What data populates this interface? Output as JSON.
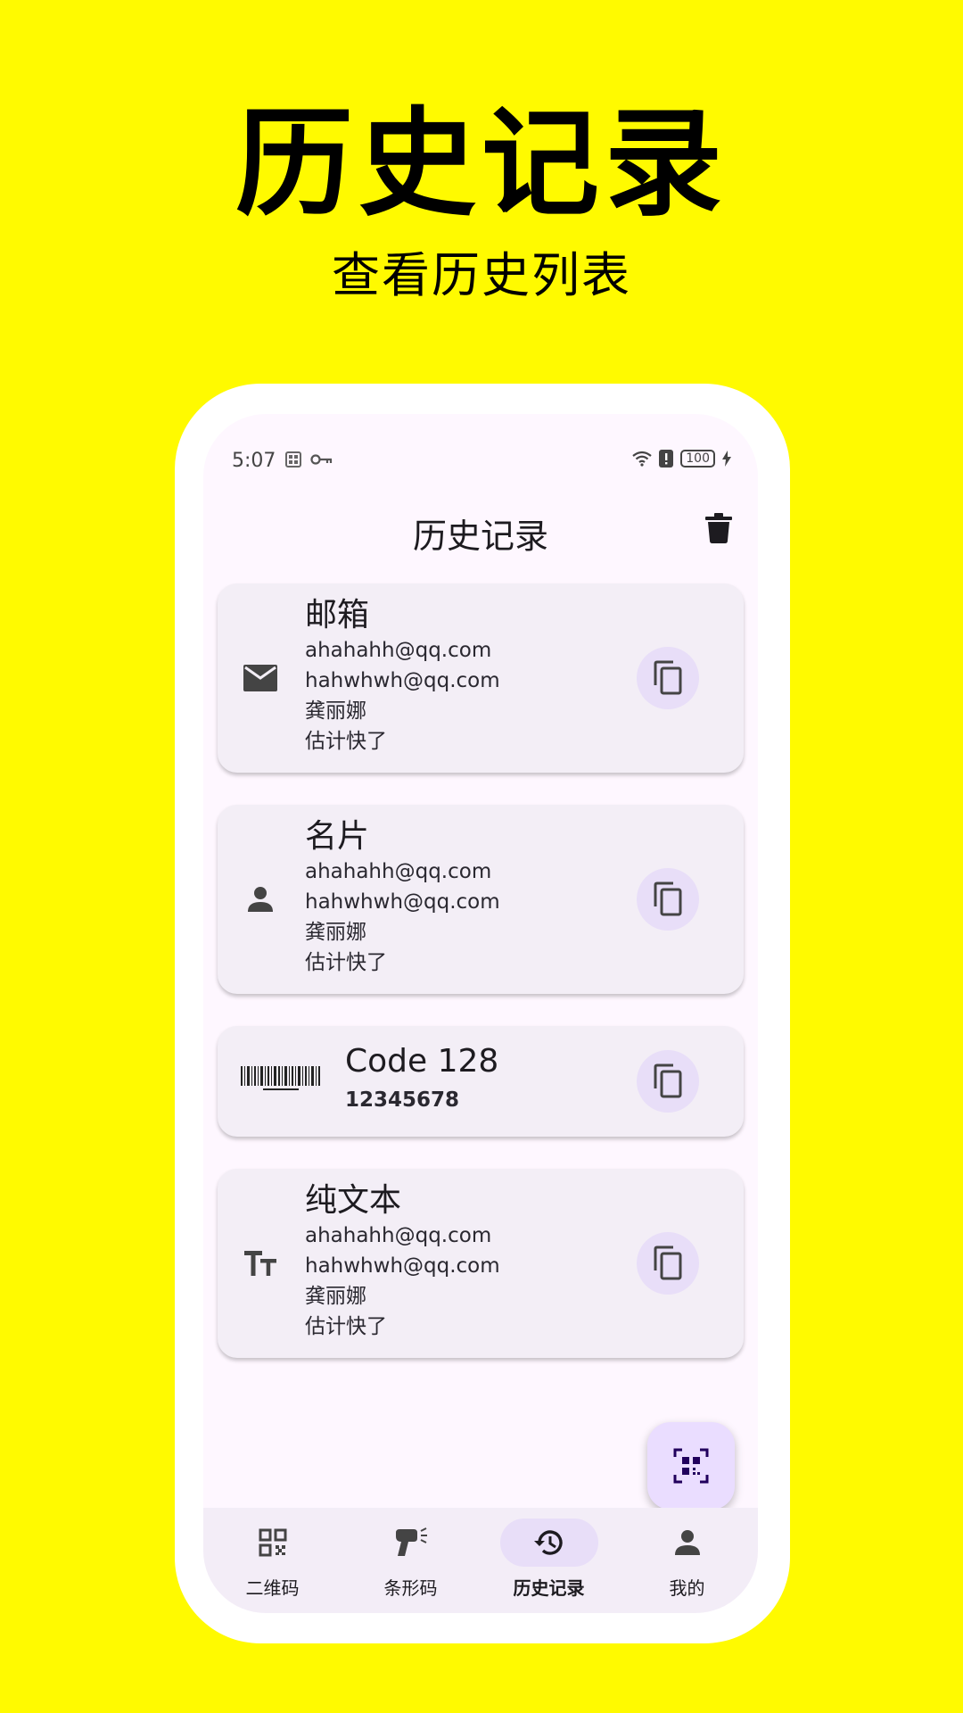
{
  "promo": {
    "title": "历史记录",
    "subtitle": "查看历史列表"
  },
  "status_bar": {
    "time": "5:07",
    "battery": "100"
  },
  "app_bar": {
    "title": "历史记录",
    "delete_icon": "trash-icon"
  },
  "history": [
    {
      "icon": "email-icon",
      "title": "邮箱",
      "lines": [
        "ahahahh@qq.com",
        "hahwhwh@qq.com",
        "龚丽娜",
        "估计快了"
      ]
    },
    {
      "icon": "person-icon",
      "title": "名片",
      "lines": [
        "ahahahh@qq.com",
        "hahwhwh@qq.com",
        "龚丽娜",
        "估计快了"
      ]
    },
    {
      "icon": "barcode-icon",
      "title": "Code 128",
      "lines": [
        "12345678"
      ]
    },
    {
      "icon": "text-format-icon",
      "title": "纯文本",
      "lines": [
        "ahahahh@qq.com",
        "hahwhwh@qq.com",
        "龚丽娜",
        "估计快了"
      ]
    }
  ],
  "fab": {
    "icon": "qr-scan-icon"
  },
  "nav": [
    {
      "label": "二维码",
      "icon": "qr-code-icon",
      "active": false
    },
    {
      "label": "条形码",
      "icon": "barcode-scanner-icon",
      "active": false
    },
    {
      "label": "历史记录",
      "icon": "history-icon",
      "active": true
    },
    {
      "label": "我的",
      "icon": "person-icon",
      "active": false
    }
  ],
  "colors": {
    "background": "#FFFA00",
    "screen": "#fef7ff",
    "card": "#f3eef6",
    "accent_container": "#e8def8",
    "fab": "#eaddff"
  }
}
